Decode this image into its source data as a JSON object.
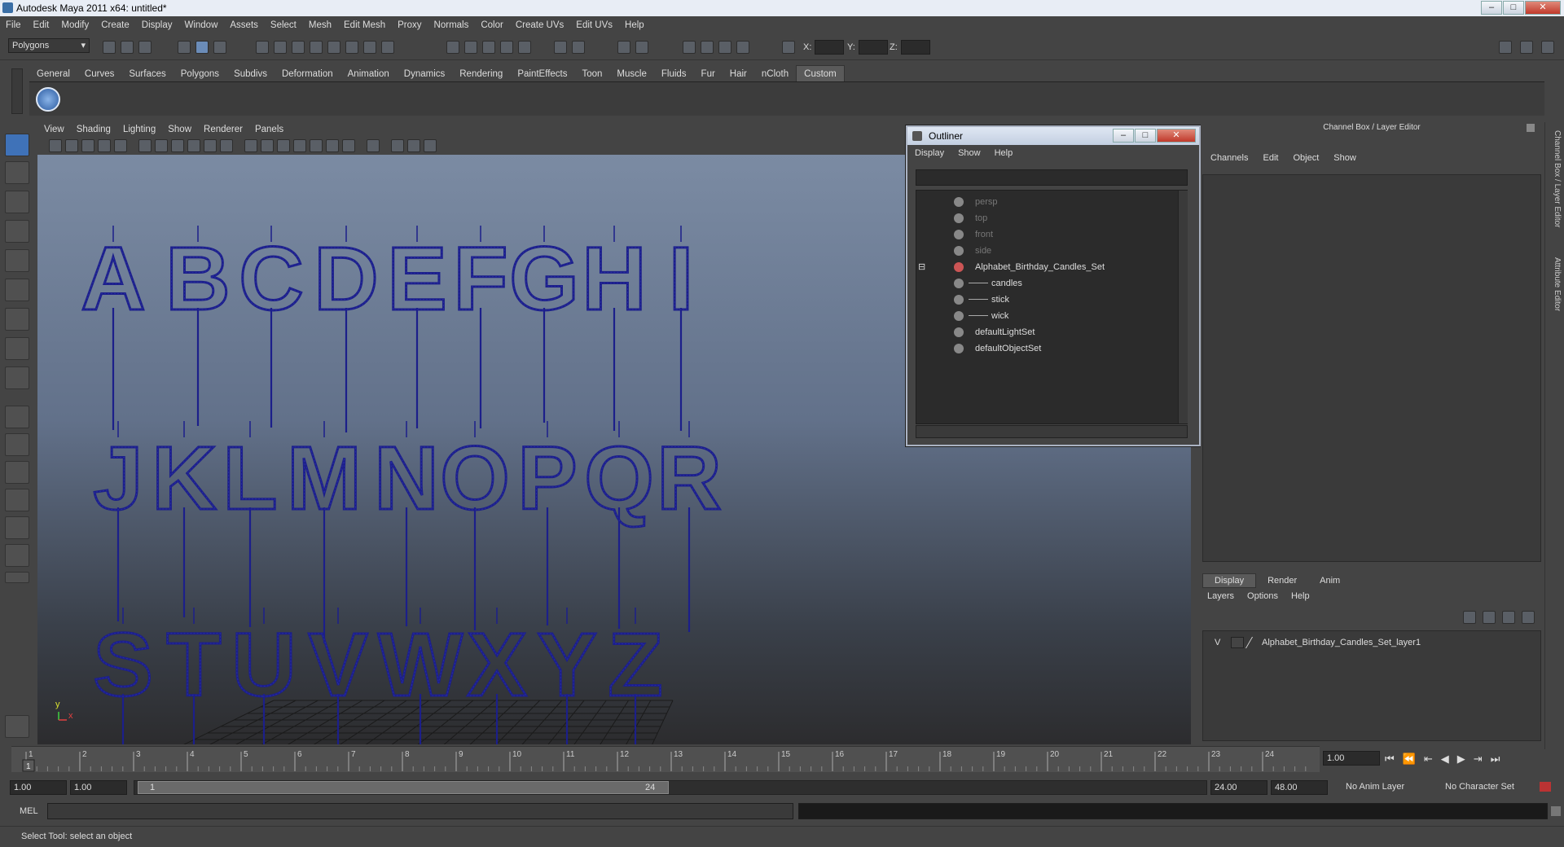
{
  "window": {
    "title": "Autodesk Maya 2011 x64: untitled*"
  },
  "menubar": [
    "File",
    "Edit",
    "Modify",
    "Create",
    "Display",
    "Window",
    "Assets",
    "Select",
    "Mesh",
    "Edit Mesh",
    "Proxy",
    "Normals",
    "Color",
    "Create UVs",
    "Edit UVs",
    "Help"
  ],
  "statusline": {
    "mode_select": "Polygons",
    "x_label": "X:",
    "y_label": "Y:",
    "z_label": "Z:"
  },
  "shelf_tabs": [
    "General",
    "Curves",
    "Surfaces",
    "Polygons",
    "Subdivs",
    "Deformation",
    "Animation",
    "Dynamics",
    "Rendering",
    "PaintEffects",
    "Toon",
    "Muscle",
    "Fluids",
    "Fur",
    "Hair",
    "nCloth",
    "Custom"
  ],
  "shelf_active": "Custom",
  "viewport": {
    "menu": [
      "View",
      "Shading",
      "Lighting",
      "Show",
      "Renderer",
      "Panels"
    ],
    "letters_row1": [
      "A",
      "B",
      "C",
      "D",
      "E",
      "F",
      "G",
      "H",
      "I"
    ],
    "letters_row2": [
      "J",
      "K",
      "L",
      "M",
      "N",
      "O",
      "P",
      "Q",
      "R"
    ],
    "letters_row3": [
      "S",
      "T",
      "U",
      "V",
      "W",
      "X",
      "Y",
      "Z"
    ],
    "wire_color": "#1c1f8a",
    "axis_y": "y",
    "axis_x": "x"
  },
  "outliner": {
    "title": "Outliner",
    "menu": [
      "Display",
      "Show",
      "Help"
    ],
    "items": [
      {
        "label": "persp",
        "dim": true
      },
      {
        "label": "top",
        "dim": true
      },
      {
        "label": "front",
        "dim": true
      },
      {
        "label": "side",
        "dim": true
      },
      {
        "label": "Alphabet_Birthday_Candles_Set",
        "dim": false
      },
      {
        "label": "candles",
        "dim": false
      },
      {
        "label": "stick",
        "dim": false
      },
      {
        "label": "wick",
        "dim": false
      },
      {
        "label": "defaultLightSet",
        "dim": false
      },
      {
        "label": "defaultObjectSet",
        "dim": false
      }
    ]
  },
  "channelbox": {
    "title": "Channel Box / Layer Editor",
    "menu": [
      "Channels",
      "Edit",
      "Object",
      "Show"
    ]
  },
  "layereditor": {
    "tabs": [
      "Display",
      "Render",
      "Anim"
    ],
    "menu": [
      "Layers",
      "Options",
      "Help"
    ],
    "layer_visibility": "V",
    "layer_name": "Alphabet_Birthday_Candles_Set_layer1"
  },
  "side_tabs": {
    "channel": "Channel Box / Layer Editor",
    "attribute": "Attribute Editor"
  },
  "timeslider": {
    "ticks": [
      "1",
      "2",
      "3",
      "4",
      "5",
      "6",
      "7",
      "8",
      "9",
      "10",
      "11",
      "12",
      "13",
      "14",
      "15",
      "16",
      "17",
      "18",
      "19",
      "20",
      "21",
      "22",
      "23",
      "24"
    ],
    "current_frame": "1.00",
    "current_marker": "1"
  },
  "rangeslider": {
    "start": "1.00",
    "start_inner": "1.00",
    "range_left": "1",
    "range_right": "24",
    "end_inner": "24.00",
    "end": "48.00",
    "anim_layer": "No Anim Layer",
    "char_set": "No Character Set"
  },
  "cmdline": {
    "label": "MEL"
  },
  "helpline": {
    "text": "Select Tool: select an object"
  }
}
